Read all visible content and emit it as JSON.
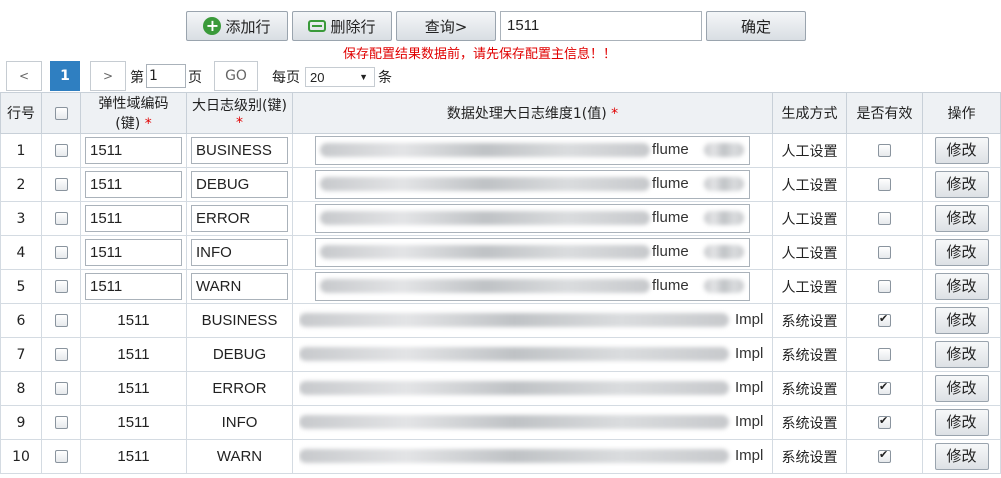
{
  "toolbar": {
    "add_label": "添加行",
    "delete_label": "删除行",
    "query_label": "查询>",
    "query_value": "1511",
    "confirm_label": "确定"
  },
  "warning": "保存配置结果数据前，请先保存配置主信息！！",
  "pagination": {
    "prev": "<",
    "current": "1",
    "next": ">",
    "page_prefix": "第",
    "page_value": "1",
    "page_suffix": "页",
    "go": "GO",
    "per_page_prefix": "每页",
    "per_page_value": "20",
    "per_page_suffix": "条"
  },
  "table": {
    "headers": {
      "row_no": "行号",
      "elastic_code": "弹性域编码",
      "elastic_code_sub": "(键)",
      "log_level": "大日志级别(键)",
      "dimension": "数据处理大日志维度1(值)",
      "gen_method": "生成方式",
      "valid": "是否有效",
      "action": "操作"
    },
    "required_mark": "*",
    "action_label": "修改",
    "rows": [
      {
        "no": "1",
        "code": "1511",
        "level": "BUSINESS",
        "dim": "flume",
        "method": "人工设置",
        "valid": false,
        "editable": true
      },
      {
        "no": "2",
        "code": "1511",
        "level": "DEBUG",
        "dim": "flume",
        "method": "人工设置",
        "valid": false,
        "editable": true
      },
      {
        "no": "3",
        "code": "1511",
        "level": "ERROR",
        "dim": "flume",
        "method": "人工设置",
        "valid": false,
        "editable": true
      },
      {
        "no": "4",
        "code": "1511",
        "level": "INFO",
        "dim": "flume",
        "method": "人工设置",
        "valid": false,
        "editable": true
      },
      {
        "no": "5",
        "code": "1511",
        "level": "WARN",
        "dim": "flume",
        "method": "人工设置",
        "valid": false,
        "editable": true
      },
      {
        "no": "6",
        "code": "1511",
        "level": "BUSINESS",
        "dim": "Impl",
        "method": "系统设置",
        "valid": true,
        "editable": false
      },
      {
        "no": "7",
        "code": "1511",
        "level": "DEBUG",
        "dim": "Impl",
        "method": "系统设置",
        "valid": false,
        "editable": false
      },
      {
        "no": "8",
        "code": "1511",
        "level": "ERROR",
        "dim": "Impl",
        "method": "系统设置",
        "valid": true,
        "editable": false
      },
      {
        "no": "9",
        "code": "1511",
        "level": "INFO",
        "dim": "Impl",
        "method": "系统设置",
        "valid": true,
        "editable": false
      },
      {
        "no": "10",
        "code": "1511",
        "level": "WARN",
        "dim": "Impl",
        "method": "系统设置",
        "valid": true,
        "editable": false
      }
    ]
  }
}
